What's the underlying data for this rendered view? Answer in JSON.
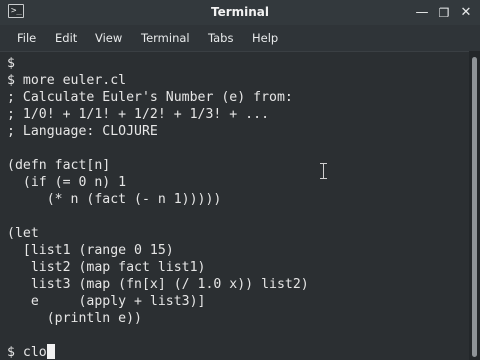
{
  "window": {
    "title": "Terminal",
    "app_icon_glyph": ">_",
    "app_icon_name": "terminal-icon",
    "minimize_glyph": "—",
    "maximize_glyph": "❐",
    "close_glyph": "✕"
  },
  "menu": {
    "items": [
      {
        "label": "File"
      },
      {
        "label": "Edit"
      },
      {
        "label": "View"
      },
      {
        "label": "Terminal"
      },
      {
        "label": "Tabs"
      },
      {
        "label": "Help"
      }
    ]
  },
  "terminal": {
    "lines": [
      "$",
      "$ more euler.cl",
      "; Calculate Euler's Number (e) from:",
      "; 1/0! + 1/1! + 1/2! + 1/3! + ...",
      "; Language: CLOJURE",
      "",
      "(defn fact[n]",
      "  (if (= 0 n) 1",
      "     (* n (fact (- n 1)))))",
      "",
      "(let",
      "  [list1 (range 0 15)",
      "   list2 (map fact list1)",
      "   list3 (map (fn[x] (/ 1.0 x)) list2)",
      "   e     (apply + list3)]",
      "     (println e))",
      "",
      "$ clo"
    ]
  },
  "colors": {
    "terminal_bg": "#2b2f32",
    "terminal_fg": "#e6e6e6",
    "titlebar_bg": "#33393d",
    "menubar_bg": "#2f3438"
  }
}
